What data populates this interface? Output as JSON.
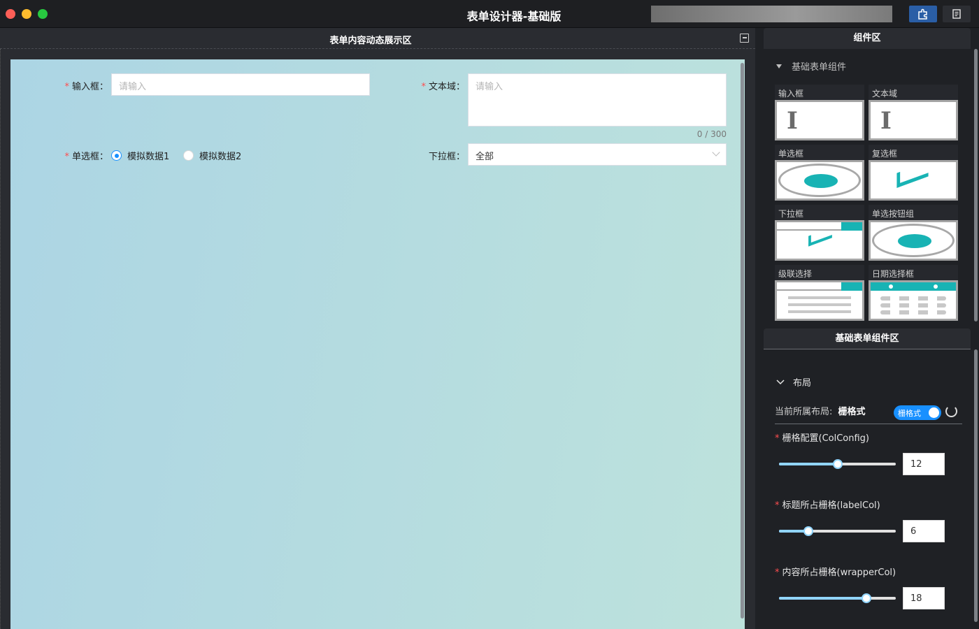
{
  "window": {
    "title": "表单设计器-基础版",
    "buttons": [
      {
        "icon": "puzzle-icon",
        "color": "#2a5ea6"
      },
      {
        "icon": "document-icon",
        "color": "#2c2e33"
      }
    ]
  },
  "left_panel": {
    "title": "表单内容动态展示区",
    "form": {
      "input": {
        "label": "输入框：",
        "placeholder": "请输入",
        "required": true
      },
      "textarea": {
        "label": "文本域：",
        "placeholder": "请输入",
        "counter": "0 / 300",
        "required": true
      },
      "radio": {
        "label": "单选框：",
        "required": true,
        "options": [
          {
            "label": "模拟数据1",
            "checked": true
          },
          {
            "label": "模拟数据2",
            "checked": false
          }
        ]
      },
      "select": {
        "label": "下拉框：",
        "value": "全部",
        "required": false
      }
    }
  },
  "right_panel": {
    "component_area_title": "组件区",
    "group_title": "基础表单组件",
    "components": [
      {
        "label": "输入框",
        "icon": "text-cursor-icon"
      },
      {
        "label": "文本域",
        "icon": "text-cursor-icon"
      },
      {
        "label": "单选框",
        "icon": "radio-icon"
      },
      {
        "label": "复选框",
        "icon": "checkbox-icon"
      },
      {
        "label": "下拉框",
        "icon": "dropdown-icon"
      },
      {
        "label": "单选按钮组",
        "icon": "radio-icon"
      },
      {
        "label": "级联选择",
        "icon": "cascader-icon"
      },
      {
        "label": "日期选择框",
        "icon": "calendar-icon"
      }
    ],
    "config_area_title": "基础表单组件区",
    "layout_section": {
      "title": "布局",
      "current_layout_label": "当前所属布局:",
      "current_layout_value": "栅格式",
      "toggle_label": "栅格式",
      "toggle_on": true
    },
    "configs": [
      {
        "label": "栅格配置(ColConfig)",
        "value": "12",
        "fraction": 0.5
      },
      {
        "label": "标题所占栅格(labelCol)",
        "value": "6",
        "fraction": 0.25
      },
      {
        "label": "内容所占栅格(wrapperCol)",
        "value": "18",
        "fraction": 0.75
      }
    ],
    "accent_color": "#18b3b4",
    "primary_color": "#1890ff"
  }
}
